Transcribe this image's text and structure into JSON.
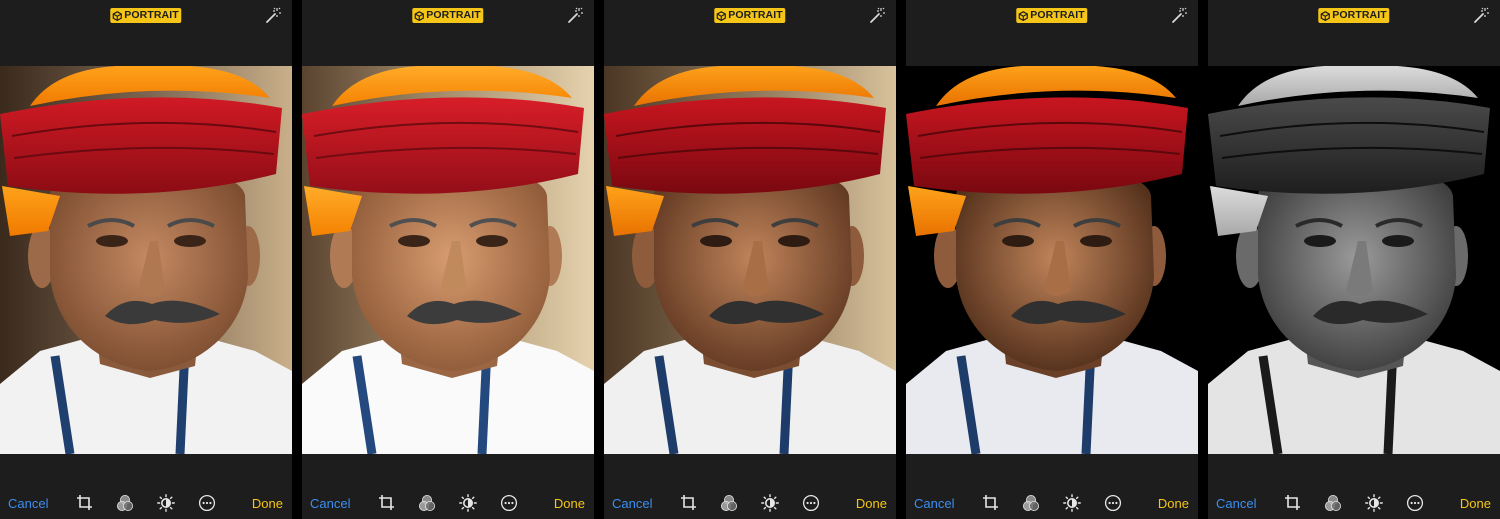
{
  "header": {
    "mode_badge_label": "PORTRAIT",
    "badge_color": "#f5c518"
  },
  "footer": {
    "cancel_label": "Cancel",
    "done_label": "Done",
    "cancel_color": "#3b8ef0",
    "done_color": "#f5c518",
    "tools": [
      "crop-rotate-icon",
      "filters-icon",
      "adjust-icon",
      "more-icon"
    ]
  },
  "screens": [
    {
      "lighting_index": 0,
      "photo_style": "natural"
    },
    {
      "lighting_index": 1,
      "photo_style": "studio"
    },
    {
      "lighting_index": 2,
      "photo_style": "contour"
    },
    {
      "lighting_index": 3,
      "photo_style": "stage"
    },
    {
      "lighting_index": 4,
      "photo_style": "stage-mono"
    }
  ],
  "lighting_options_count": 5
}
